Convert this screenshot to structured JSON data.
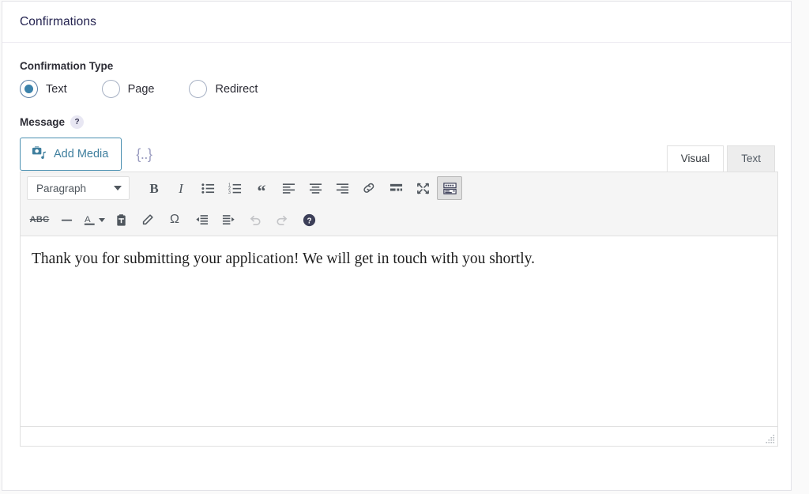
{
  "panel": {
    "title": "Confirmations"
  },
  "confirmation_type": {
    "label": "Confirmation Type",
    "options": [
      {
        "label": "Text",
        "selected": true
      },
      {
        "label": "Page",
        "selected": false
      },
      {
        "label": "Redirect",
        "selected": false
      }
    ]
  },
  "message": {
    "label": "Message",
    "help_badge": "?",
    "add_media_label": "Add Media",
    "merge_tag_label": "{..}",
    "tabs": [
      {
        "label": "Visual",
        "active": true
      },
      {
        "label": "Text",
        "active": false
      }
    ],
    "toolbar": {
      "format_select": "Paragraph",
      "row1": [
        "bold-icon",
        "italic-icon",
        "bulleted-list-icon",
        "numbered-list-icon",
        "blockquote-icon",
        "align-left-icon",
        "align-center-icon",
        "align-right-icon",
        "link-icon",
        "read-more-icon",
        "fullscreen-icon",
        "toolbar-toggle-icon"
      ],
      "row2": [
        "strikethrough-icon",
        "horizontal-rule-icon",
        "text-color-icon",
        "paste-as-text-icon",
        "clear-formatting-icon",
        "special-character-icon",
        "outdent-icon",
        "indent-icon",
        "undo-icon",
        "redo-icon",
        "keyboard-shortcuts-icon"
      ],
      "labels": {
        "bold": "B",
        "italic": "I",
        "blockquote": "“",
        "strikethrough": "ABC",
        "special_character": "Ω",
        "help": "?"
      }
    },
    "content": "Thank you for submitting your application! We will get in touch with you shortly."
  },
  "colors": {
    "accent_blue": "#3b82ab",
    "media_button_border": "#4a8fb0",
    "title_text": "#242350",
    "merge_tag": "#9a9cc0",
    "toolbar_bg": "#f5f5f5",
    "panel_border": "#e3e3e8"
  }
}
